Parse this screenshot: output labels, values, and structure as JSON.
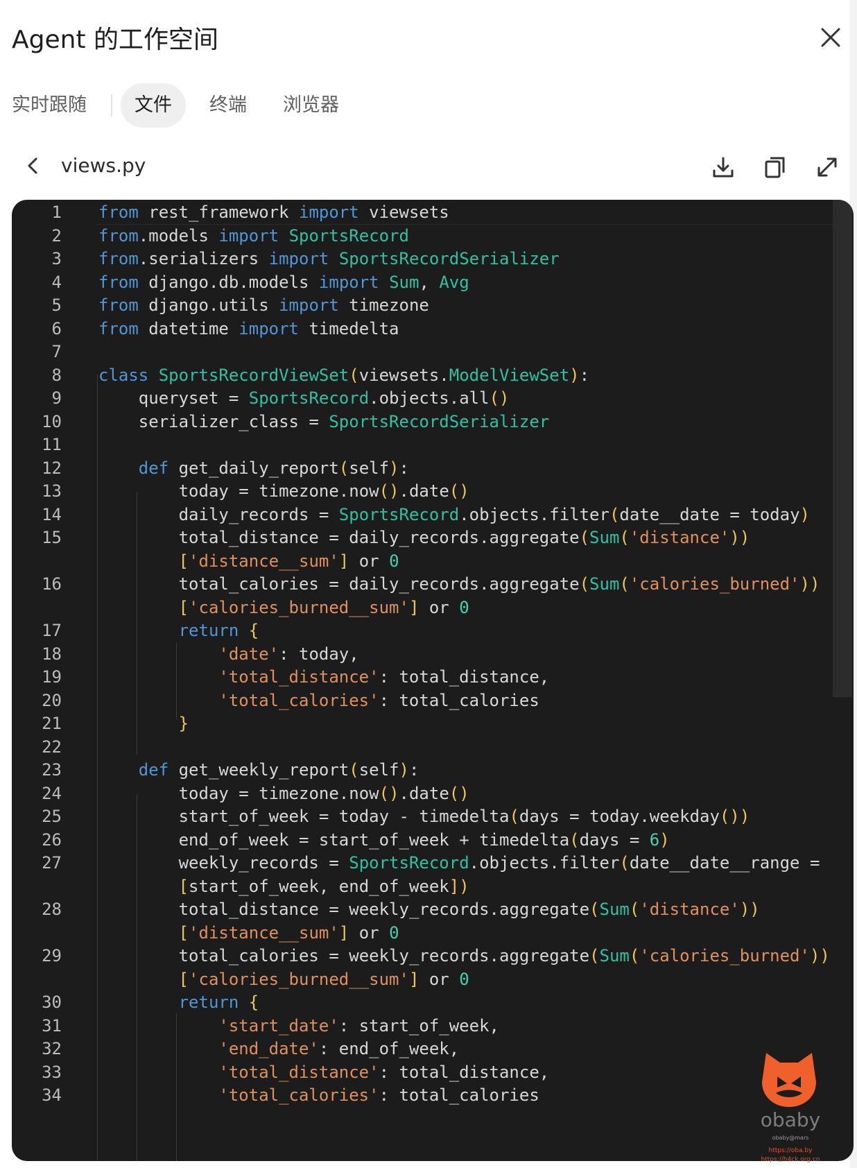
{
  "header": {
    "title": "Agent 的工作空间",
    "close_icon": "close-icon"
  },
  "tabs": [
    {
      "label": "实时跟随",
      "active": false
    },
    {
      "label": "文件",
      "active": true
    },
    {
      "label": "终端",
      "active": false
    },
    {
      "label": "浏览器",
      "active": false
    }
  ],
  "file": {
    "name": "views.py",
    "icons": [
      "chevron-left-icon",
      "download-icon",
      "copy-icon",
      "expand-icon"
    ]
  },
  "code": {
    "lines": [
      {
        "n": "1",
        "text": "from rest_framework import viewsets"
      },
      {
        "n": "2",
        "text": "from.models import SportsRecord"
      },
      {
        "n": "3",
        "text": "from.serializers import SportsRecordSerializer"
      },
      {
        "n": "4",
        "text": "from django.db.models import Sum, Avg"
      },
      {
        "n": "5",
        "text": "from django.utils import timezone"
      },
      {
        "n": "6",
        "text": "from datetime import timedelta"
      },
      {
        "n": "7",
        "text": ""
      },
      {
        "n": "8",
        "text": "class SportsRecordViewSet(viewsets.ModelViewSet):"
      },
      {
        "n": "9",
        "text": "    queryset = SportsRecord.objects.all()"
      },
      {
        "n": "10",
        "text": "    serializer_class = SportsRecordSerializer"
      },
      {
        "n": "11",
        "text": ""
      },
      {
        "n": "12",
        "text": "    def get_daily_report(self):"
      },
      {
        "n": "13",
        "text": "        today = timezone.now().date()"
      },
      {
        "n": "14",
        "text": "        daily_records = SportsRecord.objects.filter(date__date = today)"
      },
      {
        "n": "15",
        "text": "        total_distance = daily_records.aggregate(Sum('distance'))"
      },
      {
        "n": "",
        "text": "        ['distance__sum'] or 0"
      },
      {
        "n": "16",
        "text": "        total_calories = daily_records.aggregate(Sum('calories_burned'))"
      },
      {
        "n": "",
        "text": "        ['calories_burned__sum'] or 0"
      },
      {
        "n": "17",
        "text": "        return {"
      },
      {
        "n": "18",
        "text": "            'date': today,"
      },
      {
        "n": "19",
        "text": "            'total_distance': total_distance,"
      },
      {
        "n": "20",
        "text": "            'total_calories': total_calories"
      },
      {
        "n": "21",
        "text": "        }"
      },
      {
        "n": "22",
        "text": ""
      },
      {
        "n": "23",
        "text": "    def get_weekly_report(self):"
      },
      {
        "n": "24",
        "text": "        today = timezone.now().date()"
      },
      {
        "n": "25",
        "text": "        start_of_week = today - timedelta(days = today.weekday())"
      },
      {
        "n": "26",
        "text": "        end_of_week = start_of_week + timedelta(days = 6)"
      },
      {
        "n": "27",
        "text": "        weekly_records = SportsRecord.objects.filter(date__date__range ="
      },
      {
        "n": "",
        "text": "        [start_of_week, end_of_week])"
      },
      {
        "n": "28",
        "text": "        total_distance = weekly_records.aggregate(Sum('distance'))"
      },
      {
        "n": "",
        "text": "        ['distance__sum'] or 0"
      },
      {
        "n": "29",
        "text": "        total_calories = weekly_records.aggregate(Sum('calories_burned'))"
      },
      {
        "n": "",
        "text": "        ['calories_burned__sum'] or 0"
      },
      {
        "n": "30",
        "text": "        return {"
      },
      {
        "n": "31",
        "text": "            'start_date': start_of_week,"
      },
      {
        "n": "32",
        "text": "            'end_date': end_of_week,"
      },
      {
        "n": "33",
        "text": "            'total_distance': total_distance,"
      },
      {
        "n": "34",
        "text": "            'total_calories': total_calories"
      }
    ]
  },
  "watermark": {
    "name": "obaby",
    "sub": "obaby@mars",
    "url1": "https://oba.by",
    "url2": "https://h4ck.org.cn"
  },
  "colors": {
    "keyword": "#4f97d7",
    "type": "#2ec2a4",
    "string": "#e0915a",
    "number": "#3fd3b0",
    "paren": "#f0c84d",
    "watermark_orange": "#f0602c"
  }
}
